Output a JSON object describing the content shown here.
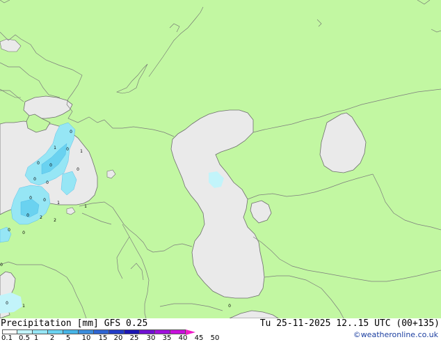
{
  "map": {
    "region": "Caspian Sea, Black Sea and surrounding region",
    "colors": {
      "land": "#c2f7a2",
      "water": "#eaeaea",
      "border": "#7c7c7c",
      "coast": "#6e6e6e"
    },
    "precip_point_labels": [
      "0",
      "1",
      "0",
      "1",
      "0",
      "0",
      "0",
      "0",
      "0",
      "0",
      "0",
      "1",
      "1",
      "0",
      "2",
      "2",
      "0",
      "0",
      "0",
      "0",
      "1",
      "0"
    ]
  },
  "footer": {
    "legend_title": "Precipitation [mm]  GFS 0.25",
    "valid_time": "Tu 25-11-2025 12..15 UTC (00+135)",
    "credit": "©weatheronline.co.uk"
  },
  "legend": {
    "ticks": [
      "0.1",
      "0.5",
      "1",
      "2",
      "5",
      "10",
      "15",
      "20",
      "25",
      "30",
      "35",
      "40",
      "45",
      "50"
    ],
    "colors": [
      "#ffffff",
      "#c2f4fa",
      "#96e6f5",
      "#6ad2f0",
      "#46b4e6",
      "#3a8cdc",
      "#2e64d2",
      "#223cc8",
      "#1c16b4",
      "#7010d2",
      "#a010dc",
      "#c810dc",
      "#f01cc8"
    ]
  }
}
